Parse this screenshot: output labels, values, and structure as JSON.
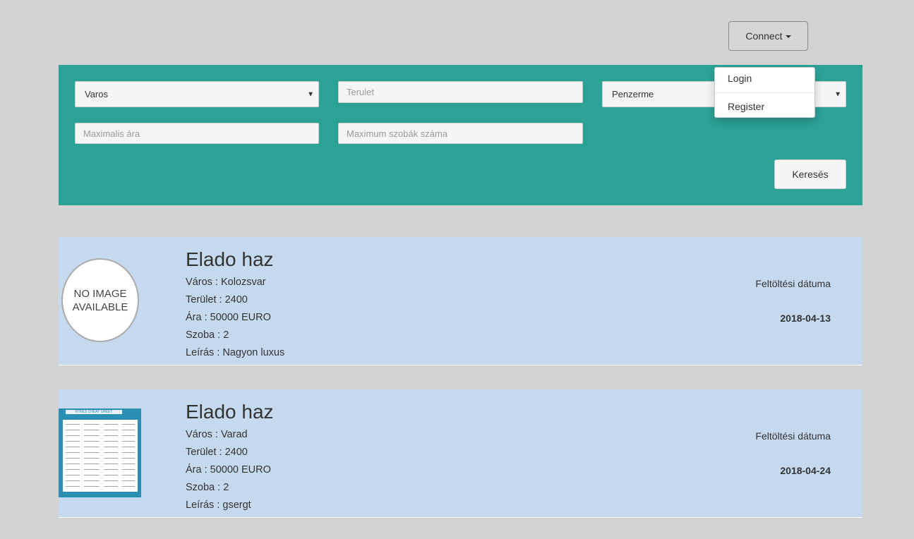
{
  "header": {
    "connect_label": "Connect"
  },
  "dropdown": {
    "items": [
      "Login",
      "Register"
    ]
  },
  "search": {
    "city_select": "Varos",
    "area_placeholder": "Terulet",
    "currency_select": "Penzerme",
    "max_price_placeholder": "Maximalis ára",
    "max_rooms_placeholder": "Maximum szobák száma",
    "search_label": "Keresés"
  },
  "listings": [
    {
      "title": "Elado haz",
      "city": "Város : Kolozsvar",
      "area": "Terület : 2400",
      "price": "Ára : 50000 EURO",
      "rooms": "Szoba : 2",
      "description": "Leírás : Nagyon luxus",
      "upload_label": "Feltöltési dátuma",
      "upload_date": "2018-04-13",
      "image_text": [
        "NO IMAGE",
        "AVAILABLE"
      ]
    },
    {
      "title": "Elado haz",
      "city": "Város : Varad",
      "area": "Terület : 2400",
      "price": "Ára : 50000 EURO",
      "rooms": "Szoba : 2",
      "description": "Leírás : gsergt",
      "upload_label": "Feltöltési dátuma",
      "upload_date": "2018-04-24",
      "image_text": "HTML5 CHEAT SHEET"
    }
  ]
}
